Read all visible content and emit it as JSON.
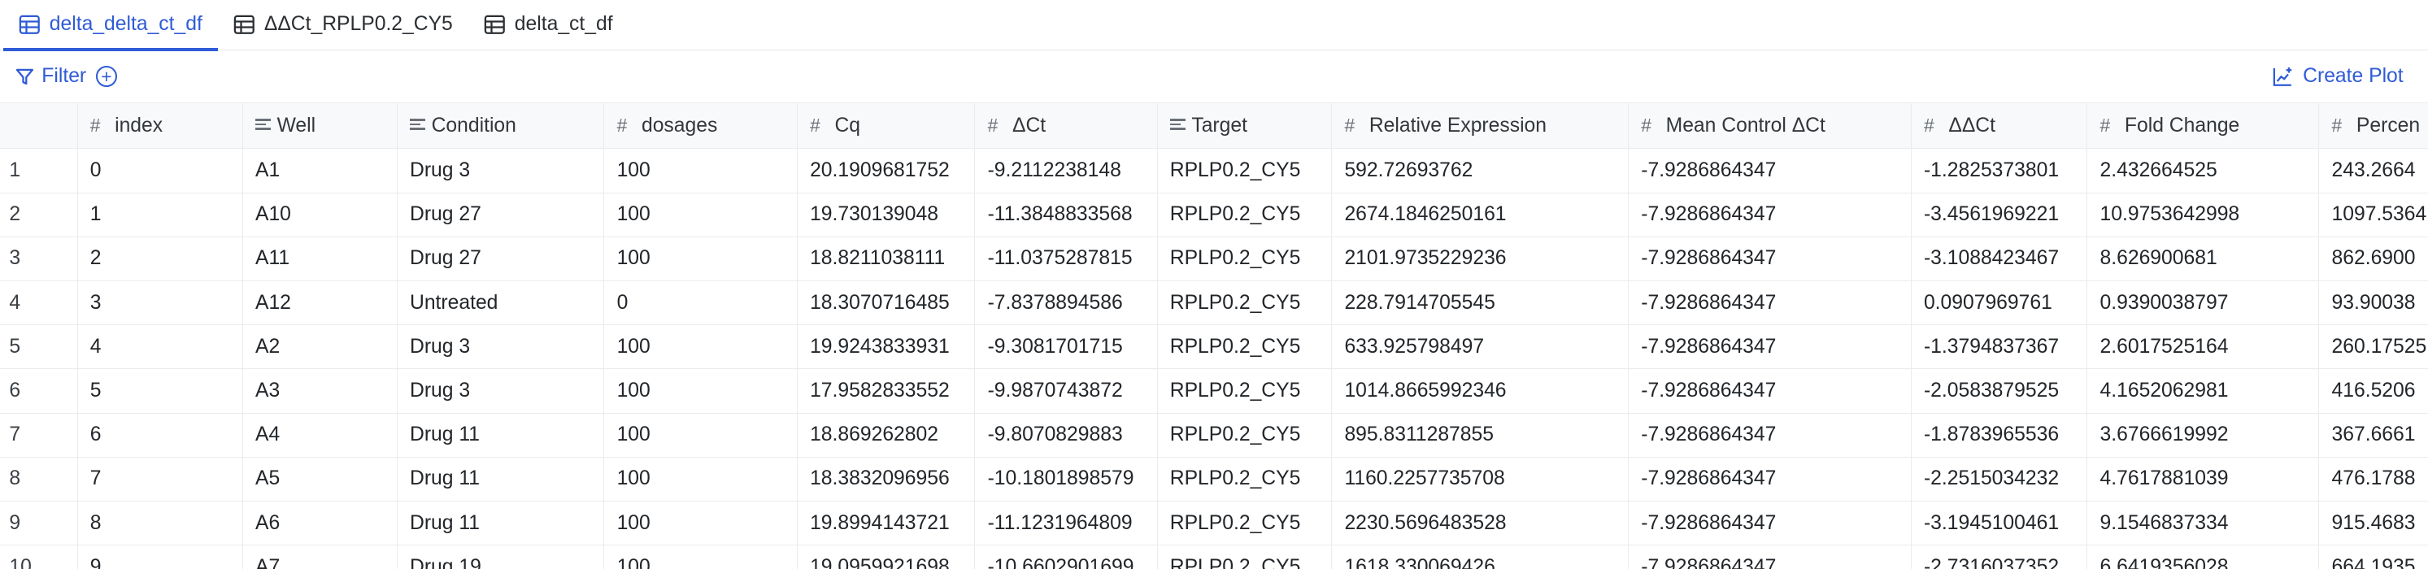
{
  "tabs": [
    {
      "label": "delta_delta_ct_df",
      "active": true
    },
    {
      "label": "ΔΔCt_RPLP0.2_CY5",
      "active": false
    },
    {
      "label": "delta_ct_df",
      "active": false
    }
  ],
  "toolbar": {
    "filter_label": "Filter",
    "create_plot_label": "Create Plot"
  },
  "colors": {
    "accent": "#2f5bd6",
    "header_bg": "#f8f9fa",
    "border": "#e9ebee"
  },
  "columns": [
    {
      "label": "",
      "type": "rownum"
    },
    {
      "label": "index",
      "type": "number"
    },
    {
      "label": "Well",
      "type": "text"
    },
    {
      "label": "Condition",
      "type": "text"
    },
    {
      "label": "dosages",
      "type": "number"
    },
    {
      "label": "Cq",
      "type": "number"
    },
    {
      "label": "ΔCt",
      "type": "number"
    },
    {
      "label": "Target",
      "type": "text"
    },
    {
      "label": "Relative Expression",
      "type": "number"
    },
    {
      "label": "Mean Control ΔCt",
      "type": "number"
    },
    {
      "label": "ΔΔCt",
      "type": "number"
    },
    {
      "label": "Fold Change",
      "type": "number"
    },
    {
      "label": "Percen",
      "type": "number"
    }
  ],
  "rows": [
    [
      "1",
      "0",
      "A1",
      "Drug 3",
      "100",
      "20.1909681752",
      "-9.2112238148",
      "RPLP0.2_CY5",
      "592.72693762",
      "-7.9286864347",
      "-1.2825373801",
      "2.432664525",
      "243.2664"
    ],
    [
      "2",
      "1",
      "A10",
      "Drug 27",
      "100",
      "19.730139048",
      "-11.3848833568",
      "RPLP0.2_CY5",
      "2674.1846250161",
      "-7.9286864347",
      "-3.4561969221",
      "10.9753642998",
      "1097.5364"
    ],
    [
      "3",
      "2",
      "A11",
      "Drug 27",
      "100",
      "18.8211038111",
      "-11.0375287815",
      "RPLP0.2_CY5",
      "2101.9735229236",
      "-7.9286864347",
      "-3.1088423467",
      "8.626900681",
      "862.6900"
    ],
    [
      "4",
      "3",
      "A12",
      "Untreated",
      "0",
      "18.3070716485",
      "-7.8378894586",
      "RPLP0.2_CY5",
      "228.7914705545",
      "-7.9286864347",
      "0.0907969761",
      "0.9390038797",
      "93.90038"
    ],
    [
      "5",
      "4",
      "A2",
      "Drug 3",
      "100",
      "19.9243833931",
      "-9.3081701715",
      "RPLP0.2_CY5",
      "633.925798497",
      "-7.9286864347",
      "-1.3794837367",
      "2.6017525164",
      "260.17525"
    ],
    [
      "6",
      "5",
      "A3",
      "Drug 3",
      "100",
      "17.9582833552",
      "-9.9870743872",
      "RPLP0.2_CY5",
      "1014.8665992346",
      "-7.9286864347",
      "-2.0583879525",
      "4.1652062981",
      "416.5206"
    ],
    [
      "7",
      "6",
      "A4",
      "Drug 11",
      "100",
      "18.869262802",
      "-9.8070829883",
      "RPLP0.2_CY5",
      "895.8311287855",
      "-7.9286864347",
      "-1.8783965536",
      "3.6766619992",
      "367.6661"
    ],
    [
      "8",
      "7",
      "A5",
      "Drug 11",
      "100",
      "18.3832096956",
      "-10.1801898579",
      "RPLP0.2_CY5",
      "1160.2257735708",
      "-7.9286864347",
      "-2.2515034232",
      "4.7617881039",
      "476.1788"
    ],
    [
      "9",
      "8",
      "A6",
      "Drug 11",
      "100",
      "19.8994143721",
      "-11.1231964809",
      "RPLP0.2_CY5",
      "2230.5696483528",
      "-7.9286864347",
      "-3.1945100461",
      "9.1546837334",
      "915.4683"
    ],
    [
      "10",
      "9",
      "A7",
      "Drug 19",
      "100",
      "19.0959921698",
      "-10.6602901699",
      "RPLP0.2_CY5",
      "1618.330069426",
      "-7.9286864347",
      "-2.7316037352",
      "6.6419356028",
      "664.1935"
    ]
  ]
}
